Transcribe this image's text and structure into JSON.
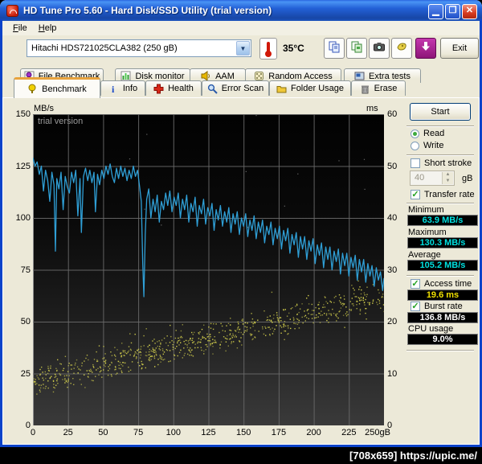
{
  "window": {
    "title": "HD Tune Pro 5.60 - Hard Disk/SSD Utility (trial version)",
    "controls": {
      "minimize": "_",
      "maximize": "❐",
      "close": "✕"
    }
  },
  "menu": {
    "items": [
      "File",
      "Help"
    ]
  },
  "toolbar": {
    "drive_select": "Hitachi HDS721025CLA382 (250 gB)",
    "temperature": "35°C",
    "buttons": [
      {
        "name": "copy-text-button",
        "icon": "copy-text-icon"
      },
      {
        "name": "copy-image-button",
        "icon": "copy-image-icon"
      },
      {
        "name": "screenshot-button",
        "icon": "camera-icon"
      },
      {
        "name": "save-button",
        "icon": "save-icon"
      },
      {
        "name": "download-button",
        "icon": "download-icon"
      }
    ],
    "exit_label": "Exit"
  },
  "tabs": {
    "row1": [
      {
        "label": "File Benchmark",
        "icon": "file-benchmark-icon"
      },
      {
        "label": "Disk monitor",
        "icon": "disk-monitor-icon"
      },
      {
        "label": "AAM",
        "icon": "aam-icon"
      },
      {
        "label": "Random Access",
        "icon": "random-access-icon"
      },
      {
        "label": "Extra tests",
        "icon": "extra-tests-icon"
      }
    ],
    "row2": [
      {
        "label": "Benchmark",
        "icon": "benchmark-icon",
        "active": true
      },
      {
        "label": "Info",
        "icon": "info-icon"
      },
      {
        "label": "Health",
        "icon": "health-icon"
      },
      {
        "label": "Error Scan",
        "icon": "error-scan-icon"
      },
      {
        "label": "Folder Usage",
        "icon": "folder-usage-icon"
      },
      {
        "label": "Erase",
        "icon": "erase-icon"
      }
    ]
  },
  "panel": {
    "start_label": "Start",
    "read": {
      "label": "Read",
      "selected": true
    },
    "write": {
      "label": "Write",
      "selected": false
    },
    "short_stroke": {
      "label": "Short stroke",
      "checked": false,
      "value": "40",
      "unit": "gB"
    },
    "transfer_rate": {
      "label": "Transfer rate",
      "checked": true
    },
    "minimum": {
      "label": "Minimum",
      "value": "63.9 MB/s"
    },
    "maximum": {
      "label": "Maximum",
      "value": "130.3 MB/s"
    },
    "average": {
      "label": "Average",
      "value": "105.2 MB/s"
    },
    "access_time": {
      "label": "Access time",
      "checked": true,
      "value": "19.6 ms"
    },
    "burst_rate": {
      "label": "Burst rate",
      "checked": true,
      "value": "136.8 MB/s"
    },
    "cpu_usage": {
      "label": "CPU usage",
      "value": "9.0%"
    }
  },
  "chart_data": {
    "type": "line+scatter",
    "watermark": "trial version",
    "left_axis": {
      "label": "MB/s",
      "min": 0,
      "max": 150,
      "ticks": [
        "150",
        "125",
        "100",
        "75",
        "50",
        "25",
        "0"
      ]
    },
    "right_axis": {
      "label": "ms",
      "min": 0,
      "max": 60,
      "ticks": [
        "60",
        "50",
        "40",
        "30",
        "20",
        "10",
        "0"
      ]
    },
    "x_axis": {
      "min": 0,
      "max": 250,
      "ticks": [
        "0",
        "25",
        "50",
        "75",
        "100",
        "125",
        "150",
        "175",
        "200",
        "225",
        "250gB"
      ]
    },
    "grid": true,
    "transfer_rate_series": {
      "name": "Transfer rate (MB/s vs gB)",
      "color": "#2F9FD6",
      "points": [
        [
          0,
          129
        ],
        [
          1.5,
          125
        ],
        [
          3,
          127
        ],
        [
          4.5,
          121
        ],
        [
          6,
          125
        ],
        [
          7.5,
          113
        ],
        [
          9,
          123
        ],
        [
          10.5,
          118
        ],
        [
          12,
          108
        ],
        [
          13.5,
          122
        ],
        [
          15,
          116
        ],
        [
          16,
          84
        ],
        [
          17,
          119
        ],
        [
          18.5,
          114
        ],
        [
          20,
          122
        ],
        [
          21.5,
          104
        ],
        [
          23,
          120
        ],
        [
          24.5,
          115
        ],
        [
          26,
          112
        ],
        [
          27.5,
          122
        ],
        [
          29,
          117
        ],
        [
          30.5,
          123
        ],
        [
          32,
          101
        ],
        [
          33.5,
          119
        ],
        [
          34.5,
          93
        ],
        [
          36,
          120
        ],
        [
          37.5,
          124
        ],
        [
          39,
          118
        ],
        [
          40.5,
          123
        ],
        [
          42,
          117
        ],
        [
          43.5,
          122
        ],
        [
          44.5,
          103
        ],
        [
          46,
          121
        ],
        [
          47.5,
          116
        ],
        [
          49,
          123
        ],
        [
          50.5,
          119
        ],
        [
          52,
          125
        ],
        [
          53.5,
          121
        ],
        [
          55,
          126
        ],
        [
          56.5,
          120
        ],
        [
          58,
          117
        ],
        [
          59.5,
          124
        ],
        [
          61,
          119
        ],
        [
          62.5,
          125
        ],
        [
          64,
          120
        ],
        [
          65.5,
          124
        ],
        [
          67,
          118
        ],
        [
          68.5,
          123
        ],
        [
          70,
          119
        ],
        [
          71.5,
          125
        ],
        [
          73,
          120
        ],
        [
          74.5,
          123
        ],
        [
          76,
          115
        ],
        [
          77.2,
          108
        ],
        [
          78.2,
          78
        ],
        [
          79,
          62
        ],
        [
          80,
          92
        ],
        [
          81,
          109
        ],
        [
          82.5,
          114
        ],
        [
          84,
          100
        ],
        [
          85.5,
          109
        ],
        [
          87,
          103
        ],
        [
          88.5,
          111
        ],
        [
          90,
          98
        ],
        [
          91.5,
          108
        ],
        [
          93,
          104
        ],
        [
          94.5,
          112
        ],
        [
          96,
          106
        ],
        [
          97.5,
          113
        ],
        [
          99,
          103
        ],
        [
          100.5,
          110
        ],
        [
          102,
          106
        ],
        [
          103.5,
          112
        ],
        [
          105,
          100
        ],
        [
          106.5,
          109
        ],
        [
          108,
          104
        ],
        [
          109.5,
          111
        ],
        [
          111,
          98
        ],
        [
          112.5,
          107
        ],
        [
          114,
          103
        ],
        [
          115.5,
          110
        ],
        [
          117,
          96
        ],
        [
          118.5,
          106
        ],
        [
          120,
          102
        ],
        [
          121.5,
          109
        ],
        [
          123,
          97
        ],
        [
          124.5,
          105
        ],
        [
          126,
          101
        ],
        [
          127.5,
          107
        ],
        [
          129,
          94
        ],
        [
          130.5,
          104
        ],
        [
          132,
          99
        ],
        [
          133.5,
          106
        ],
        [
          135,
          96
        ],
        [
          136.5,
          103
        ],
        [
          138,
          98
        ],
        [
          139.5,
          105
        ],
        [
          141,
          93
        ],
        [
          142.5,
          102
        ],
        [
          144,
          97
        ],
        [
          145.5,
          103
        ],
        [
          147,
          92
        ],
        [
          148.5,
          100
        ],
        [
          150,
          96
        ],
        [
          151.5,
          102
        ],
        [
          153,
          91
        ],
        [
          154.5,
          99
        ],
        [
          156,
          94
        ],
        [
          157.5,
          101
        ],
        [
          159,
          90
        ],
        [
          160.5,
          98
        ],
        [
          162,
          93
        ],
        [
          163.5,
          99
        ],
        [
          165,
          88
        ],
        [
          166.5,
          96
        ],
        [
          168,
          92
        ],
        [
          169.5,
          98
        ],
        [
          171,
          87
        ],
        [
          172.5,
          95
        ],
        [
          174,
          90
        ],
        [
          175.5,
          96
        ],
        [
          177,
          85
        ],
        [
          178.5,
          94
        ],
        [
          180,
          89
        ],
        [
          181.5,
          95
        ],
        [
          183,
          83
        ],
        [
          184.5,
          92
        ],
        [
          186,
          87
        ],
        [
          187.5,
          93
        ],
        [
          189,
          81
        ],
        [
          190.5,
          91
        ],
        [
          192,
          85
        ],
        [
          193.5,
          91
        ],
        [
          195,
          80
        ],
        [
          196.5,
          89
        ],
        [
          198,
          84
        ],
        [
          199.5,
          90
        ],
        [
          201,
          78
        ],
        [
          202.5,
          87
        ],
        [
          204,
          82
        ],
        [
          205.5,
          88
        ],
        [
          207,
          76
        ],
        [
          208.5,
          86
        ],
        [
          210,
          80
        ],
        [
          211.5,
          86
        ],
        [
          213,
          75
        ],
        [
          214.5,
          84
        ],
        [
          216,
          79
        ],
        [
          217.5,
          85
        ],
        [
          219,
          73
        ],
        [
          220.5,
          83
        ],
        [
          222,
          77
        ],
        [
          223.5,
          83
        ],
        [
          225,
          72
        ],
        [
          226.5,
          81
        ],
        [
          228,
          76
        ],
        [
          229.5,
          82
        ],
        [
          231,
          70
        ],
        [
          232.5,
          80
        ],
        [
          234,
          74
        ],
        [
          235.5,
          80
        ],
        [
          237,
          69
        ],
        [
          238.5,
          78
        ],
        [
          240,
          72
        ],
        [
          241.5,
          77
        ],
        [
          243,
          67
        ],
        [
          244.5,
          76
        ],
        [
          246,
          70
        ],
        [
          247.5,
          74
        ],
        [
          249,
          65
        ],
        [
          250,
          71
        ]
      ]
    },
    "access_time_scatter": {
      "name": "Access time (ms vs gB)",
      "color": "#D8D44E",
      "count": 780,
      "seed": 12345,
      "ms_start": 8.5,
      "ms_end": 25,
      "spread": 3.4,
      "outlier_rate": 0.05,
      "outlier_extra": 5
    },
    "noise_specks": {
      "count": 14,
      "seed": 99,
      "color": "#C8C8C8"
    }
  },
  "credit": {
    "text": "[708x659] https://upic.me/"
  }
}
